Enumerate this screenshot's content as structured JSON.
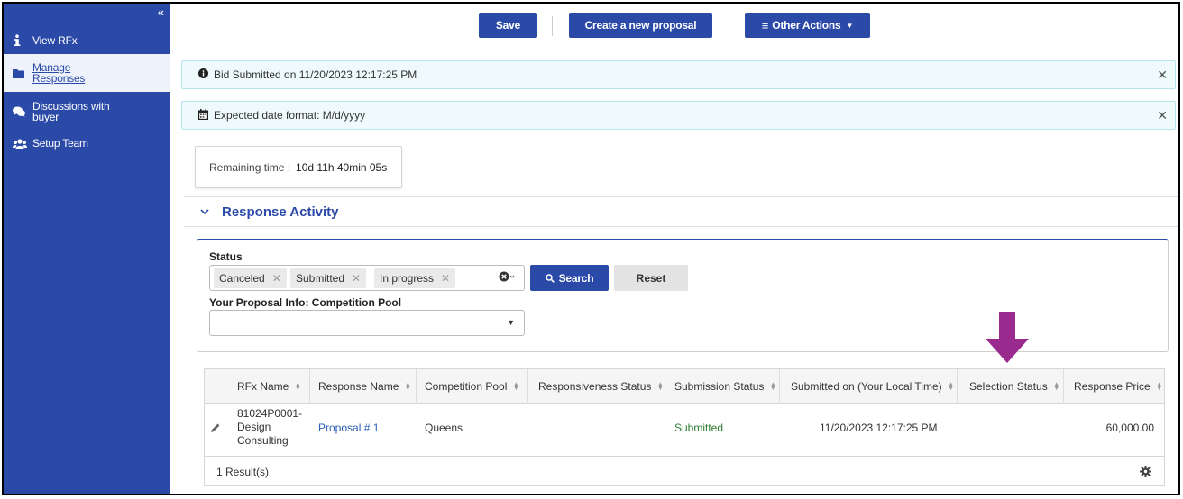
{
  "sidebar": {
    "collapse_icon": "double-chevron-left-icon",
    "items": [
      {
        "label": "View RFx",
        "icon": "info-icon"
      },
      {
        "label_lines": [
          "Manage",
          "Responses"
        ],
        "icon": "folder-icon"
      },
      {
        "label_lines": [
          "Discussions with",
          "buyer"
        ],
        "icon": "chat-icon"
      },
      {
        "label": "Setup Team",
        "icon": "users-icon"
      }
    ]
  },
  "toolbar": {
    "save_label": "Save",
    "create_label": "Create a new proposal",
    "other_actions_label": "Other Actions",
    "other_actions_icon": "menu-icon"
  },
  "alerts": [
    {
      "text": "Bid Submitted on 11/20/2023 12:17:25 PM",
      "icon": "info-circle-icon"
    },
    {
      "text": "Expected date format: M/d/yyyy",
      "icon": "calendar-icon"
    }
  ],
  "remaining": {
    "label": "Remaining time :",
    "value": "10d 11h 40min 05s"
  },
  "panel": {
    "title": "Response Activity"
  },
  "filters": {
    "status_label": "Status",
    "status_tags": [
      "Canceled",
      "Submitted",
      "In progress"
    ],
    "pool_label": "Your Proposal Info: Competition Pool",
    "pool_value": "",
    "search_label": "Search",
    "reset_label": "Reset"
  },
  "table": {
    "columns": [
      "RFx Name",
      "Response Name",
      "Competition Pool",
      "Responsiveness Status",
      "Submission Status",
      "Submitted on (Your Local Time)",
      "Selection Status",
      "Response Price"
    ],
    "rows": [
      {
        "rfx_name_lines": [
          "81024P0001-",
          "Design",
          "Consulting"
        ],
        "response_name": "Proposal # 1",
        "competition_pool": "Queens",
        "responsiveness_status": "",
        "submission_status": "Submitted",
        "submitted_on": "11/20/2023 12:17:25 PM",
        "selection_status": "",
        "response_price": "60,000.00"
      }
    ],
    "result_count": "1 Result(s)"
  },
  "colors": {
    "brand": "#2b4aa8",
    "link": "#2b5fb8",
    "submitted": "#2e7d32",
    "arrow": "#9b2a8e",
    "alert_bg": "#eefafc"
  }
}
